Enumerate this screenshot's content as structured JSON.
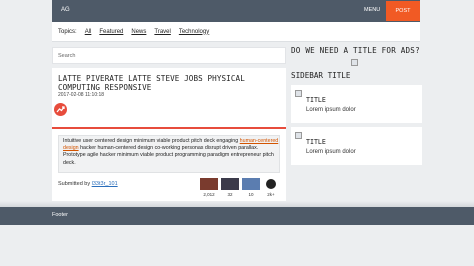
{
  "header": {
    "brand": "AG",
    "menu_label": "MENU",
    "post_label": "POST",
    "accent_color": "#f15a24"
  },
  "topics": {
    "label": "Topics:",
    "items": [
      "All",
      "Featured",
      "News",
      "Travel",
      "Technology"
    ]
  },
  "search": {
    "placeholder": "Search"
  },
  "post": {
    "title": "LATTE PIVERATE LATTE STEVE JOBS PHYSICAL COMPUTING RESPONSIVE",
    "date": "2017-02-08 11:10:18",
    "badge_icon": "trending-icon",
    "excerpt_before": "Intuitive user centered design minimum viable product pitch deck engaging ",
    "excerpt_link": "human-centered design",
    "excerpt_after": " hacker human-centered design co-working personas disrupt driven parallax. Prototype agile hacker minimum viable product programming paradigm entrepreneur pitch deck.",
    "submitted_label": "Submitted by",
    "author": "l33t3r_101",
    "avatars": [
      {
        "count": "2,012",
        "color": "#7a3b2e"
      },
      {
        "count": "32",
        "color": "#3b3a4a"
      },
      {
        "count": "10",
        "color": "#5b7db0"
      }
    ],
    "more_label": "2k+"
  },
  "sidebar": {
    "ad_heading": "DO WE NEED A TITLE FOR ADS?",
    "title": "SIDEBAR TITLE",
    "cards": [
      {
        "title": "TITLE",
        "text": "Lorem ipsum dolor"
      },
      {
        "title": "TITLE",
        "text": "Lorem ipsum dolor"
      }
    ]
  },
  "footer": {
    "text": "Footer"
  }
}
